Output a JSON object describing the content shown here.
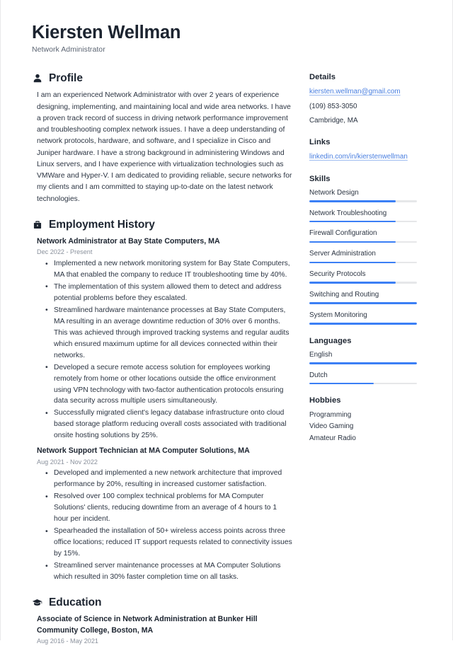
{
  "header": {
    "name": "Kiersten Wellman",
    "subtitle": "Network Administrator"
  },
  "colors": {
    "accent": "#3b7ff5",
    "link": "#4a7fe0",
    "text": "#2b3442",
    "heading": "#1c2430",
    "muted": "#8a919c",
    "track": "#e6e7e9"
  },
  "sections": {
    "profile": {
      "title": "Profile",
      "icon": "person-icon",
      "text": "I am an experienced Network Administrator with over 2 years of experience designing, implementing, and maintaining local and wide area networks. I have a proven track record of success in driving network performance improvement and troubleshooting complex network issues. I have a deep understanding of network protocols, hardware, and software, and I specialize in Cisco and Juniper hardware. I have a strong background in administering Windows and Linux servers, and I have experience with virtualization technologies such as VMWare and Hyper-V. I am dedicated to providing reliable, secure networks for my clients and I am committed to staying up-to-date on the latest network technologies."
    },
    "employment": {
      "title": "Employment History",
      "icon": "briefcase-icon",
      "jobs": [
        {
          "title": "Network Administrator at Bay State Computers, MA",
          "date": "Dec 2022 - Present",
          "bullets": [
            "Implemented a new network monitoring system for Bay State Computers, MA that enabled the company to reduce IT troubleshooting time by 40%.",
            "The implementation of this system allowed them to detect and address potential problems before they escalated.",
            "Streamlined hardware maintenance processes at Bay State Computers, MA resulting in an average downtime reduction of 30% over 6 months. This was achieved through improved tracking systems and regular audits which ensured maximum uptime for all devices connected within their networks.",
            "Developed a secure remote access solution for employees working remotely from home or other locations outside the office environment using VPN technology with two-factor authentication protocols ensuring data security across multiple users simultaneously.",
            "Successfully migrated client's legacy database infrastructure onto cloud based storage platform reducing overall costs associated with traditional onsite hosting solutions by 25%."
          ]
        },
        {
          "title": "Network Support Technician at MA Computer Solutions, MA",
          "date": "Aug 2021 - Nov 2022",
          "bullets": [
            "Developed and implemented a new network architecture that improved performance by 20%, resulting in increased customer satisfaction.",
            "Resolved over 100 complex technical problems for MA Computer Solutions' clients, reducing downtime from an average of 4 hours to 1 hour per incident.",
            "Spearheaded the installation of 50+ wireless access points across three office locations; reduced IT support requests related to connectivity issues by 15%.",
            "Streamlined server maintenance processes at MA Computer Solutions which resulted in 30% faster completion time on all tasks."
          ]
        }
      ]
    },
    "education": {
      "title": "Education",
      "icon": "graduation-cap-icon",
      "entries": [
        {
          "title": "Associate of Science in Network Administration at Bunker Hill Community College, Boston, MA",
          "date": "Aug 2016 - May 2021"
        }
      ]
    }
  },
  "sidebar": {
    "details": {
      "title": "Details",
      "email": "kiersten.wellman@gmail.com",
      "phone": "(109) 853-3050",
      "location": "Cambridge, MA"
    },
    "links": {
      "title": "Links",
      "items": [
        {
          "label": "linkedin.com/in/kierstenwellman"
        }
      ]
    },
    "skills": {
      "title": "Skills",
      "items": [
        {
          "label": "Network Design",
          "level": 80
        },
        {
          "label": "Network Troubleshooting",
          "level": 80
        },
        {
          "label": "Firewall Configuration",
          "level": 80
        },
        {
          "label": "Server Administration",
          "level": 80
        },
        {
          "label": "Security Protocols",
          "level": 80
        },
        {
          "label": "Switching and Routing",
          "level": 100
        },
        {
          "label": "System Monitoring",
          "level": 100
        }
      ]
    },
    "languages": {
      "title": "Languages",
      "items": [
        {
          "label": "English",
          "level": 100
        },
        {
          "label": "Dutch",
          "level": 60
        }
      ]
    },
    "hobbies": {
      "title": "Hobbies",
      "items": [
        {
          "label": "Programming"
        },
        {
          "label": "Video Gaming"
        },
        {
          "label": "Amateur Radio"
        }
      ]
    }
  }
}
